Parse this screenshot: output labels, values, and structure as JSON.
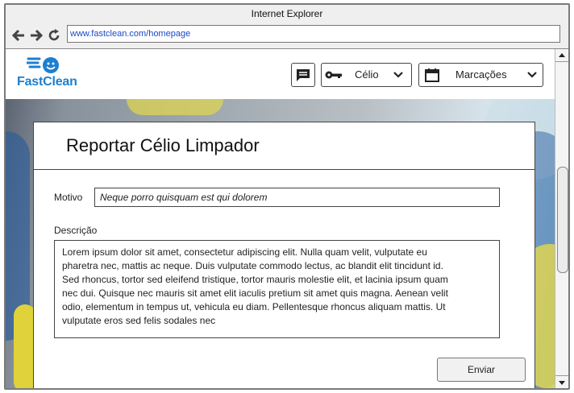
{
  "window": {
    "title": "Internet Explorer"
  },
  "browser": {
    "url": "www.fastclean.com/homepage",
    "icons": {
      "back": "arrow-left-icon",
      "forward": "arrow-right-icon",
      "reload": "reload-icon"
    }
  },
  "header": {
    "logo_text": "FastClean",
    "chat_icon": "chat-icon",
    "user_menu": {
      "icon": "key-icon",
      "label": "Célio"
    },
    "appointments_menu": {
      "icon": "calendar-icon",
      "label": "Marcações"
    }
  },
  "form": {
    "title": "Reportar Célio Limpador",
    "motivo_label": "Motivo",
    "motivo_value": "Neque porro quisquam est qui dolorem",
    "descricao_label": "Descrição",
    "descricao_value": "Lorem ipsum dolor sit amet, consectetur adipiscing elit. Nulla quam velit, vulputate eu pharetra nec, mattis ac neque. Duis vulputate commodo lectus, ac blandit elit tincidunt id. Sed rhoncus, tortor sed eleifend tristique, tortor mauris molestie elit, et lacinia ipsum quam nec dui. Quisque nec mauris sit amet elit iaculis pretium sit amet quis magna. Aenean velit odio, elementum in tempus ut, vehicula eu diam. Pellentesque rhoncus aliquam mattis. Ut vulputate eros sed felis sodales nec",
    "submit_label": "Enviar"
  },
  "colors": {
    "brand": "#1d7fcf",
    "url": "#1a49c8"
  }
}
